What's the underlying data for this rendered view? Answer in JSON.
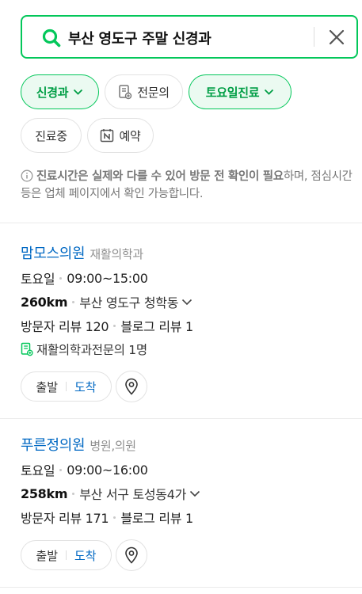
{
  "search": {
    "query": "부산 영도구 주말 신경과"
  },
  "filters": {
    "chips": [
      {
        "label": "신경과",
        "active": true
      },
      {
        "label": "전문의",
        "active": false
      },
      {
        "label": "토요일진료",
        "active": true
      },
      {
        "label": "진료중",
        "active": false
      },
      {
        "label": "예약",
        "active": false
      }
    ]
  },
  "notice": {
    "bold": "진료시간은 실제와 다를 수 있어 방문 전 확인이 필요",
    "rest": "하며, 점심시간 등은 업체 페이지에서 확인 가능합니다."
  },
  "results": [
    {
      "name": "맘모스의원",
      "category": "재활의학과",
      "day": "토요일",
      "hours": "09:00~15:00",
      "distance": "260km",
      "address": "부산 영도구 청학동",
      "visitor_reviews": "방문자 리뷰 120",
      "blog_reviews": "블로그 리뷰 1",
      "specialist": "재활의학과전문의 1명",
      "depart_label": "출발",
      "arrive_label": "도착"
    },
    {
      "name": "푸른정의원",
      "category": "병원,의원",
      "day": "토요일",
      "hours": "09:00~16:00",
      "distance": "258km",
      "address": "부산 서구 토성동4가",
      "visitor_reviews": "방문자 리뷰 171",
      "blog_reviews": "블로그 리뷰 1",
      "depart_label": "출발",
      "arrive_label": "도착"
    }
  ],
  "colors": {
    "accent": "#03c75a",
    "link": "#0068c3"
  }
}
